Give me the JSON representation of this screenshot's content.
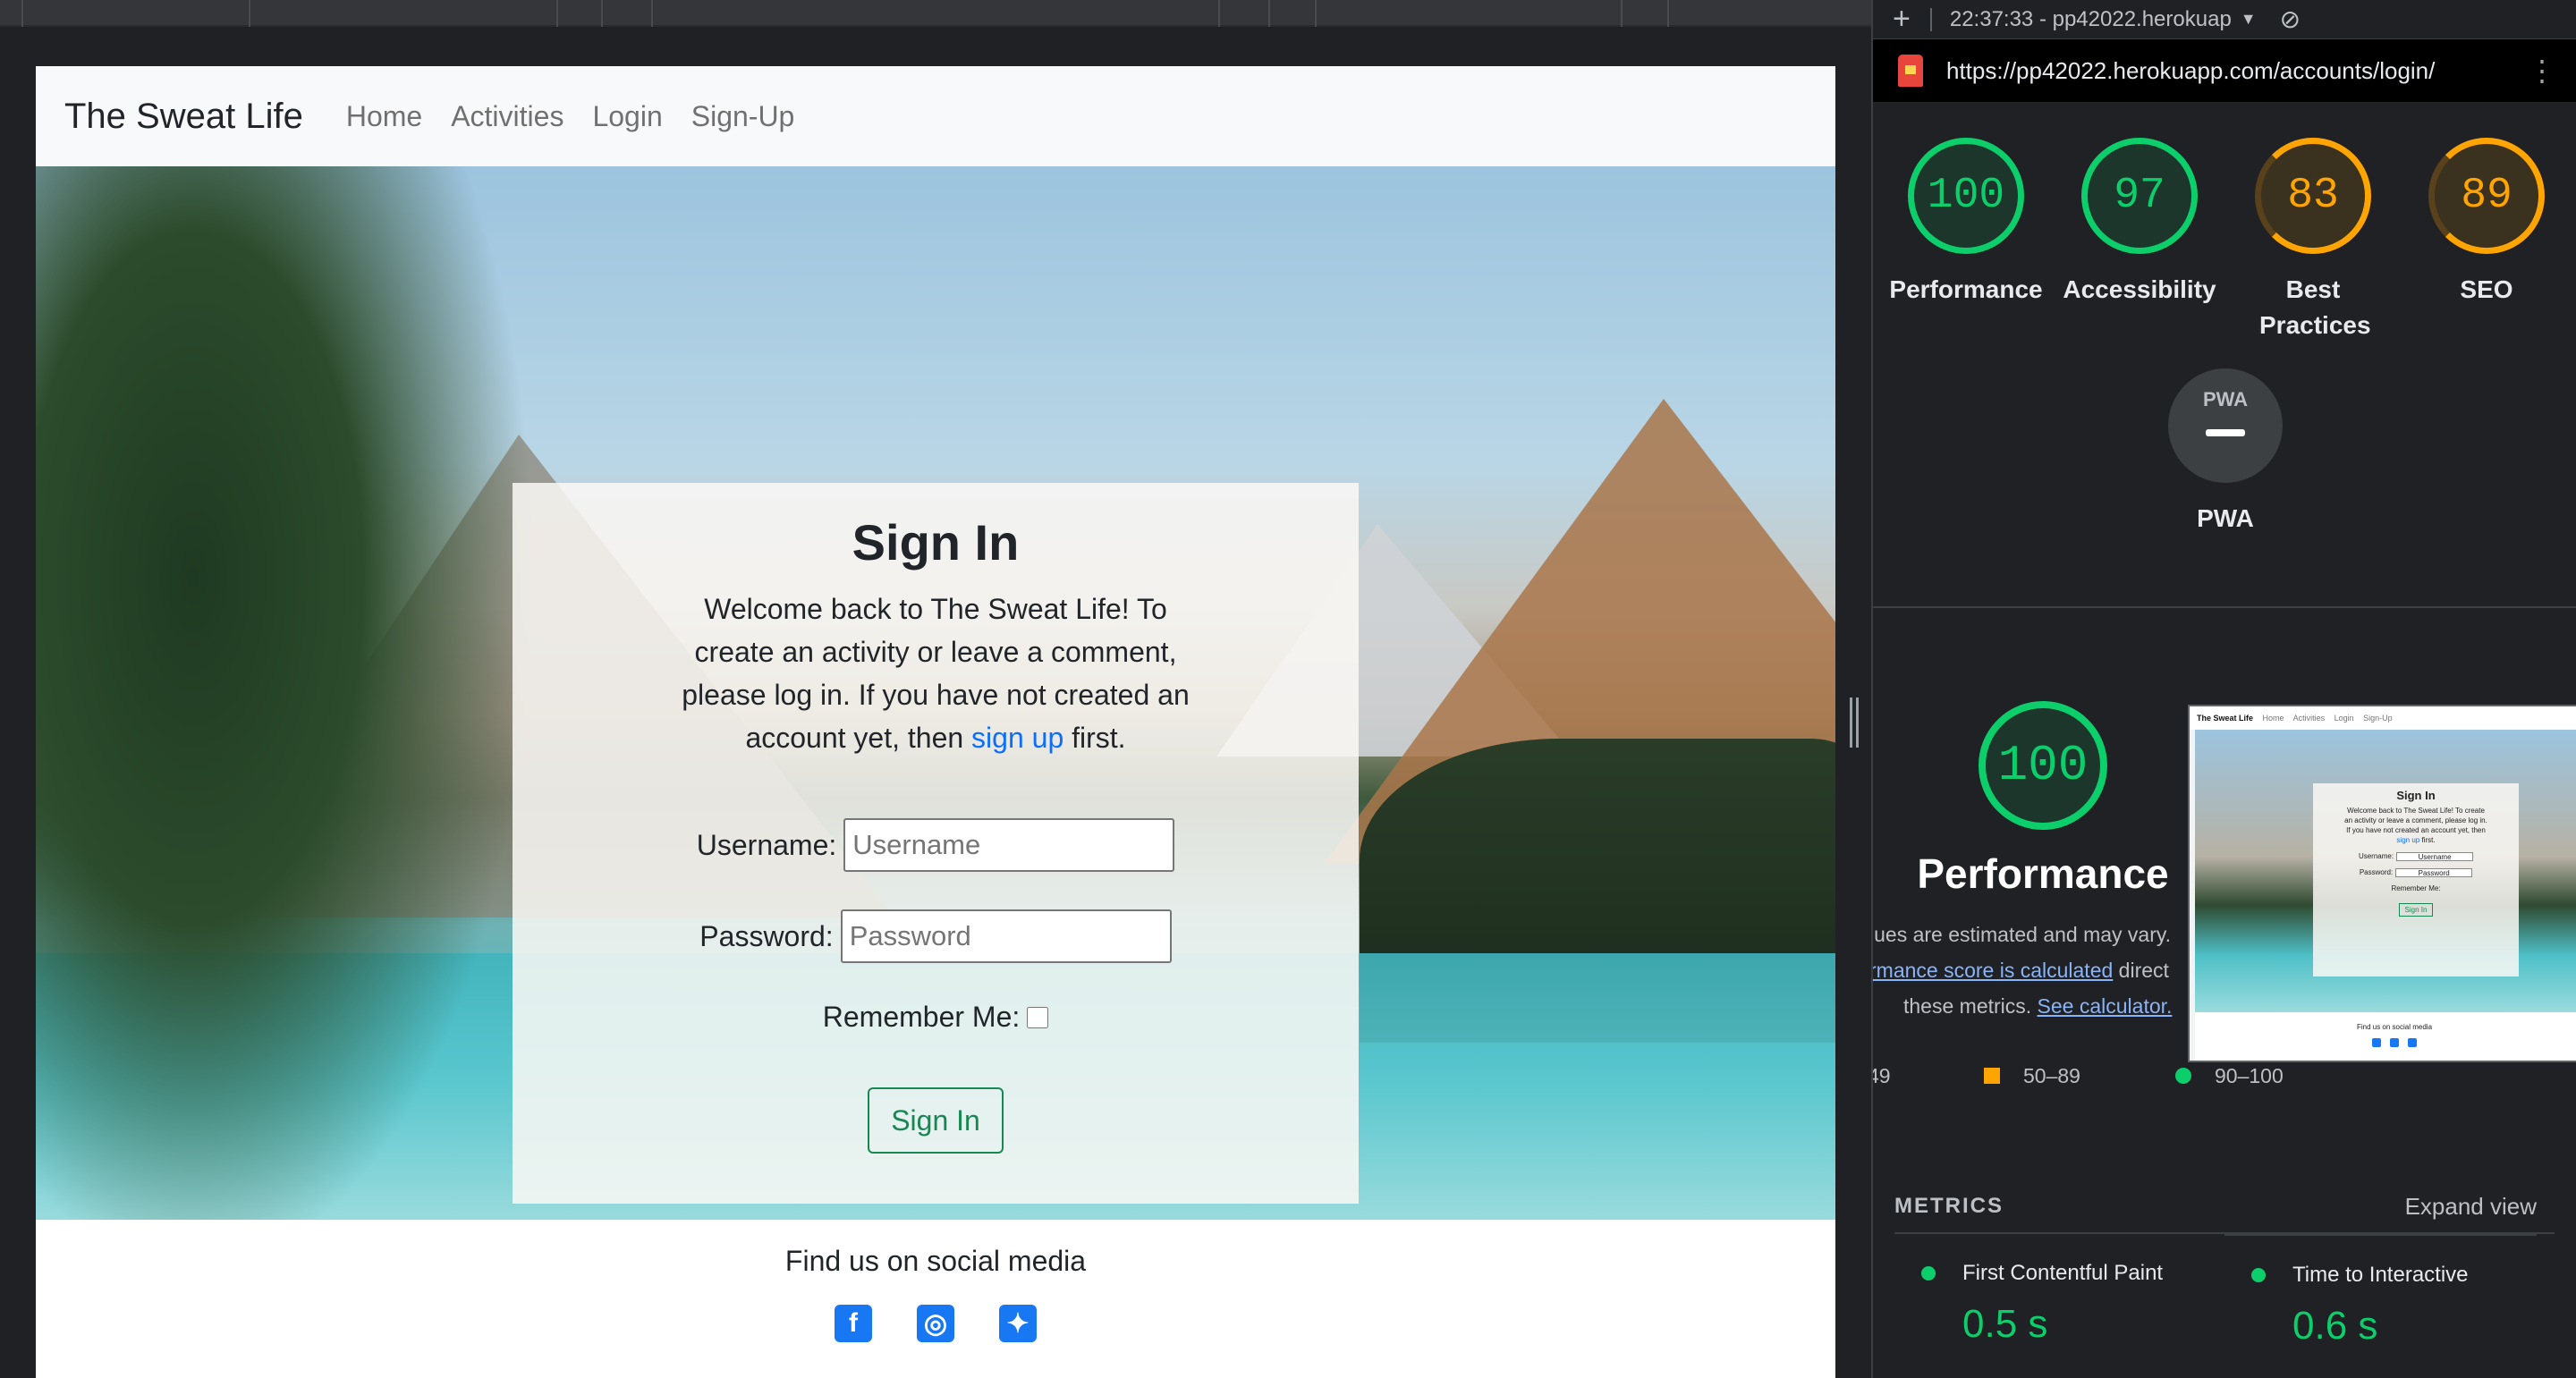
{
  "site": {
    "brand": "The Sweat Life",
    "nav": [
      "Home",
      "Activities",
      "Login",
      "Sign-Up"
    ],
    "signin": {
      "title": "Sign In",
      "welcome_before": "Welcome back to The Sweat Life! To create an activity or leave a comment, please log in. If you have not created an account yet, then ",
      "signup_link": "sign up",
      "welcome_after": " first.",
      "username_label": "Username:",
      "username_placeholder": "Username",
      "password_label": "Password:",
      "password_placeholder": "Password",
      "remember_label": "Remember Me:",
      "button": "Sign In"
    },
    "footer": {
      "title": "Find us on social media",
      "icons": [
        "facebook-icon",
        "instagram-icon",
        "twitter-icon"
      ]
    }
  },
  "devtools": {
    "report": "22:37:33 - pp42022.herokuap",
    "url": "https://pp42022.herokuapp.com/accounts/login/",
    "scores": [
      {
        "label": "Performance",
        "value": "100",
        "status": "good"
      },
      {
        "label": "Accessibility",
        "value": "97",
        "status": "good"
      },
      {
        "label": "Best Practices",
        "value": "83",
        "status": "average"
      },
      {
        "label": "SEO",
        "value": "89",
        "status": "average"
      }
    ],
    "pwa": {
      "label": "PWA",
      "badge": "PWA"
    },
    "performance": {
      "score": "100",
      "title": "Performance",
      "note1": "lues are estimated and may vary.",
      "note2_link": "rmance score is calculated",
      "note2_after": " direct",
      "note3_before": "these metrics. ",
      "note3_link": "See calculator."
    },
    "thumbnail": {
      "brand": "The Sweat Life",
      "nav": [
        "Home",
        "Activities",
        "Login",
        "Sign-Up"
      ],
      "title": "Sign In",
      "body_before": "Welcome back to The Sweat Life! To create an activity or leave a comment, please log in. If you have not created an account yet, then ",
      "body_link": "sign up",
      "body_after": " first.",
      "username": "Username:",
      "username_ph": "Username",
      "password": "Password:",
      "password_ph": "Password",
      "remember": "Remember Me:",
      "button": "Sign In",
      "footer": "Find us on social media"
    },
    "legend": {
      "fail": "49",
      "average": "50–89",
      "good": "90–100"
    },
    "metrics": {
      "title": "METRICS",
      "expand": "Expand view",
      "items": [
        {
          "label": "First Contentful Paint",
          "value": "0.5 s"
        },
        {
          "label": "Time to Interactive",
          "value": "0.6 s"
        }
      ]
    }
  },
  "colors": {
    "good": "#0cce6b",
    "average": "#ffa400",
    "link": "#0d6efd",
    "button": "#198754"
  }
}
